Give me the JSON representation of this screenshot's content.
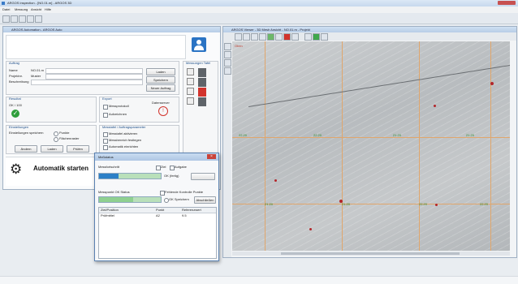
{
  "os_window": {
    "title": "ARGOS inspection - [NO.01.m] - ARGOS 3D",
    "menu": [
      "Datei",
      "Messung",
      "Ansicht",
      "Hilfe"
    ]
  },
  "left_panel": {
    "title": "ARGOS Automation - ARGOS Auto",
    "auftrag": {
      "section": "Auftrag",
      "rows": [
        {
          "label": "Name",
          "value": "NO.01.m"
        },
        {
          "label": "Projektnr.",
          "value": "Muster"
        },
        {
          "label": "Beschreibung",
          "value": ""
        }
      ],
      "buttons": [
        "Laden",
        "Speichern",
        "Neuer Auftrag"
      ]
    },
    "side_group_title": "Messungen Tafel",
    "resultat": {
      "section": "Resultat",
      "value": "OK / 100"
    },
    "export": {
      "section": "Export",
      "opt1": "Messprotokoll",
      "opt2": "Aufzeichnen",
      "status_label": "Datenserver"
    },
    "einstellungen": {
      "section": "Einstellungen",
      "left": "Einstellungen speichern",
      "opt1": "Punkte",
      "opt2": "Flächenraster",
      "buttons": [
        "Ändern",
        "Laden",
        "Prüfen"
      ]
    },
    "messtafel": {
      "section": "Messtafel / Auftragsparameter",
      "items": [
        "Messtafel aktivieren",
        "Messbereich festlegen",
        "Automatik einrichten"
      ]
    },
    "start_label": "Automatik starten"
  },
  "viewer": {
    "title": "ARGOS Viewer - 3D Mesh Ansicht - NO.01.m - Projekt",
    "tag": "Oben",
    "labels": [
      "22.20",
      "22.20",
      "21.20",
      "21.20",
      "21.20",
      "21.20",
      "22.20",
      "22.20"
    ]
  },
  "dialog": {
    "title": "Meßstatus",
    "row1_label": "Messfortschritt",
    "row1_right_a": "Ziel",
    "row1_right_b": "Aufgabe",
    "row1_btn": "OK (fertig)",
    "progress_a": 0.32,
    "progress_b": 0.55,
    "row2_label": "Messpunkt OK Status",
    "row2_right": "Fehlende Kontrolle Punkte",
    "row2_opt": "OK Speichern",
    "row2_btn": "Abschließen",
    "table_headers": [
      "Ziel/Position",
      "Punkt",
      "Referenzwert"
    ],
    "table_rows": [
      [
        "Prüfmittel",
        "A2",
        "9.5"
      ]
    ]
  },
  "colors": {
    "accent": "#1e6fbf",
    "ok_green": "#2e9e3b",
    "alert_red": "#d2332c",
    "progress_fill": "#2c7fc7",
    "progress_track": "#b9e0ba"
  }
}
